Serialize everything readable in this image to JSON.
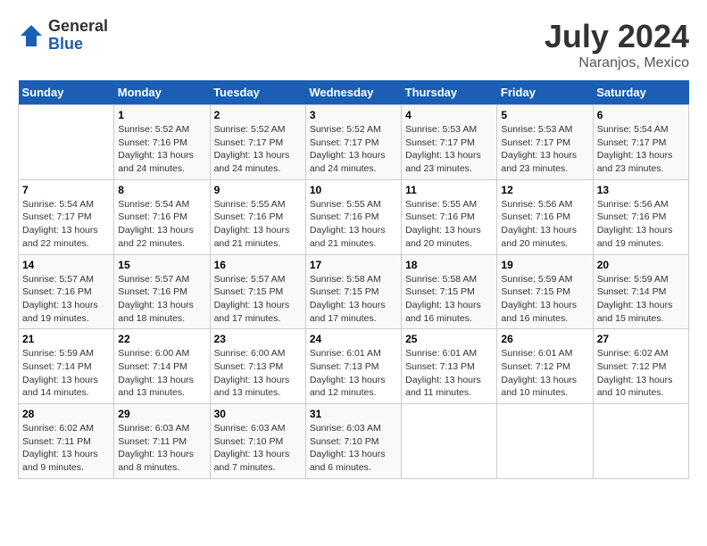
{
  "header": {
    "logo_general": "General",
    "logo_blue": "Blue",
    "title": "July 2024",
    "location": "Naranjos, Mexico"
  },
  "days_of_week": [
    "Sunday",
    "Monday",
    "Tuesday",
    "Wednesday",
    "Thursday",
    "Friday",
    "Saturday"
  ],
  "weeks": [
    [
      {
        "day": "",
        "sunrise": "",
        "sunset": "",
        "daylight": ""
      },
      {
        "day": "1",
        "sunrise": "Sunrise: 5:52 AM",
        "sunset": "Sunset: 7:16 PM",
        "daylight": "Daylight: 13 hours and 24 minutes."
      },
      {
        "day": "2",
        "sunrise": "Sunrise: 5:52 AM",
        "sunset": "Sunset: 7:17 PM",
        "daylight": "Daylight: 13 hours and 24 minutes."
      },
      {
        "day": "3",
        "sunrise": "Sunrise: 5:52 AM",
        "sunset": "Sunset: 7:17 PM",
        "daylight": "Daylight: 13 hours and 24 minutes."
      },
      {
        "day": "4",
        "sunrise": "Sunrise: 5:53 AM",
        "sunset": "Sunset: 7:17 PM",
        "daylight": "Daylight: 13 hours and 23 minutes."
      },
      {
        "day": "5",
        "sunrise": "Sunrise: 5:53 AM",
        "sunset": "Sunset: 7:17 PM",
        "daylight": "Daylight: 13 hours and 23 minutes."
      },
      {
        "day": "6",
        "sunrise": "Sunrise: 5:54 AM",
        "sunset": "Sunset: 7:17 PM",
        "daylight": "Daylight: 13 hours and 23 minutes."
      }
    ],
    [
      {
        "day": "7",
        "sunrise": "Sunrise: 5:54 AM",
        "sunset": "Sunset: 7:17 PM",
        "daylight": "Daylight: 13 hours and 22 minutes."
      },
      {
        "day": "8",
        "sunrise": "Sunrise: 5:54 AM",
        "sunset": "Sunset: 7:16 PM",
        "daylight": "Daylight: 13 hours and 22 minutes."
      },
      {
        "day": "9",
        "sunrise": "Sunrise: 5:55 AM",
        "sunset": "Sunset: 7:16 PM",
        "daylight": "Daylight: 13 hours and 21 minutes."
      },
      {
        "day": "10",
        "sunrise": "Sunrise: 5:55 AM",
        "sunset": "Sunset: 7:16 PM",
        "daylight": "Daylight: 13 hours and 21 minutes."
      },
      {
        "day": "11",
        "sunrise": "Sunrise: 5:55 AM",
        "sunset": "Sunset: 7:16 PM",
        "daylight": "Daylight: 13 hours and 20 minutes."
      },
      {
        "day": "12",
        "sunrise": "Sunrise: 5:56 AM",
        "sunset": "Sunset: 7:16 PM",
        "daylight": "Daylight: 13 hours and 20 minutes."
      },
      {
        "day": "13",
        "sunrise": "Sunrise: 5:56 AM",
        "sunset": "Sunset: 7:16 PM",
        "daylight": "Daylight: 13 hours and 19 minutes."
      }
    ],
    [
      {
        "day": "14",
        "sunrise": "Sunrise: 5:57 AM",
        "sunset": "Sunset: 7:16 PM",
        "daylight": "Daylight: 13 hours and 19 minutes."
      },
      {
        "day": "15",
        "sunrise": "Sunrise: 5:57 AM",
        "sunset": "Sunset: 7:16 PM",
        "daylight": "Daylight: 13 hours and 18 minutes."
      },
      {
        "day": "16",
        "sunrise": "Sunrise: 5:57 AM",
        "sunset": "Sunset: 7:15 PM",
        "daylight": "Daylight: 13 hours and 17 minutes."
      },
      {
        "day": "17",
        "sunrise": "Sunrise: 5:58 AM",
        "sunset": "Sunset: 7:15 PM",
        "daylight": "Daylight: 13 hours and 17 minutes."
      },
      {
        "day": "18",
        "sunrise": "Sunrise: 5:58 AM",
        "sunset": "Sunset: 7:15 PM",
        "daylight": "Daylight: 13 hours and 16 minutes."
      },
      {
        "day": "19",
        "sunrise": "Sunrise: 5:59 AM",
        "sunset": "Sunset: 7:15 PM",
        "daylight": "Daylight: 13 hours and 16 minutes."
      },
      {
        "day": "20",
        "sunrise": "Sunrise: 5:59 AM",
        "sunset": "Sunset: 7:14 PM",
        "daylight": "Daylight: 13 hours and 15 minutes."
      }
    ],
    [
      {
        "day": "21",
        "sunrise": "Sunrise: 5:59 AM",
        "sunset": "Sunset: 7:14 PM",
        "daylight": "Daylight: 13 hours and 14 minutes."
      },
      {
        "day": "22",
        "sunrise": "Sunrise: 6:00 AM",
        "sunset": "Sunset: 7:14 PM",
        "daylight": "Daylight: 13 hours and 13 minutes."
      },
      {
        "day": "23",
        "sunrise": "Sunrise: 6:00 AM",
        "sunset": "Sunset: 7:13 PM",
        "daylight": "Daylight: 13 hours and 13 minutes."
      },
      {
        "day": "24",
        "sunrise": "Sunrise: 6:01 AM",
        "sunset": "Sunset: 7:13 PM",
        "daylight": "Daylight: 13 hours and 12 minutes."
      },
      {
        "day": "25",
        "sunrise": "Sunrise: 6:01 AM",
        "sunset": "Sunset: 7:13 PM",
        "daylight": "Daylight: 13 hours and 11 minutes."
      },
      {
        "day": "26",
        "sunrise": "Sunrise: 6:01 AM",
        "sunset": "Sunset: 7:12 PM",
        "daylight": "Daylight: 13 hours and 10 minutes."
      },
      {
        "day": "27",
        "sunrise": "Sunrise: 6:02 AM",
        "sunset": "Sunset: 7:12 PM",
        "daylight": "Daylight: 13 hours and 10 minutes."
      }
    ],
    [
      {
        "day": "28",
        "sunrise": "Sunrise: 6:02 AM",
        "sunset": "Sunset: 7:11 PM",
        "daylight": "Daylight: 13 hours and 9 minutes."
      },
      {
        "day": "29",
        "sunrise": "Sunrise: 6:03 AM",
        "sunset": "Sunset: 7:11 PM",
        "daylight": "Daylight: 13 hours and 8 minutes."
      },
      {
        "day": "30",
        "sunrise": "Sunrise: 6:03 AM",
        "sunset": "Sunset: 7:10 PM",
        "daylight": "Daylight: 13 hours and 7 minutes."
      },
      {
        "day": "31",
        "sunrise": "Sunrise: 6:03 AM",
        "sunset": "Sunset: 7:10 PM",
        "daylight": "Daylight: 13 hours and 6 minutes."
      },
      {
        "day": "",
        "sunrise": "",
        "sunset": "",
        "daylight": ""
      },
      {
        "day": "",
        "sunrise": "",
        "sunset": "",
        "daylight": ""
      },
      {
        "day": "",
        "sunrise": "",
        "sunset": "",
        "daylight": ""
      }
    ]
  ]
}
